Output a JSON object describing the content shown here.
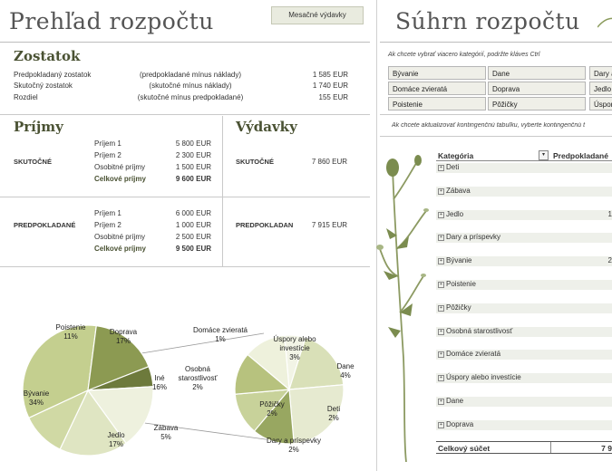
{
  "left": {
    "title": "Prehľad rozpočtu",
    "monthly_button": "Mesačné výdavky",
    "balance": {
      "heading": "Zostatok",
      "rows": [
        {
          "label": "Predpokladaný zostatok",
          "formula": "(predpokladané mínus náklady)",
          "value": "1 585 EUR"
        },
        {
          "label": "Skutočný zostatok",
          "formula": "(skutočné mínus náklady)",
          "value": "1 740 EUR"
        },
        {
          "label": "Rozdiel",
          "formula": "(skutočné mínus predpokladané)",
          "value": "155 EUR"
        }
      ]
    },
    "income": {
      "heading": "Príjmy",
      "actual": {
        "label": "SKUTOČNÉ",
        "rows": [
          {
            "label": "Príjem 1",
            "value": "5 800 EUR"
          },
          {
            "label": "Príjem 2",
            "value": "2 300 EUR"
          },
          {
            "label": "Osobitné príjmy",
            "value": "1 500 EUR"
          }
        ],
        "total_label": "Celkové príjmy",
        "total_value": "9 600 EUR"
      },
      "planned": {
        "label": "PREDPOKLADANÉ",
        "rows": [
          {
            "label": "Príjem 1",
            "value": "6 000 EUR"
          },
          {
            "label": "Príjem 2",
            "value": "1 000 EUR"
          },
          {
            "label": "Osobitné príjmy",
            "value": "2 500 EUR"
          }
        ],
        "total_label": "Celkové príjmy",
        "total_value": "9 500 EUR"
      }
    },
    "expenses": {
      "heading": "Výdavky",
      "actual_label": "SKUTOČNÉ",
      "actual_value": "7 860 EUR",
      "planned_label": "PREDPOKLADAN",
      "planned_value": "7 915 EUR"
    }
  },
  "right": {
    "title": "Súhrn rozpočtu",
    "hint_select": "Ak chcete vybrať viacero kategórií, podržte kláves Ctrl",
    "slicer_items": [
      "Bývanie",
      "Dane",
      "Dary a",
      "Domáce zvieratá",
      "Doprava",
      "Jedlo",
      "Poistenie",
      "Pôžičky",
      "Úspory"
    ],
    "hint_pivot": "Ak chcete aktualizovať kontingenčnú tabuľku, vyberte kontingenčnú t",
    "pivot": {
      "col_category": "Kategória",
      "col_planned": "Predpokladané",
      "rows": [
        "Deti",
        "Zábava",
        "Jedlo",
        "Dary a príspevky",
        "Bývanie",
        "Poistenie",
        "Pôžičky",
        "Osobná starostlivosť",
        "Domáce zvieratá",
        "Úspory alebo investície",
        "Dane",
        "Doprava"
      ],
      "partial_values": [
        "",
        "",
        "1",
        "",
        "2",
        "",
        "",
        "",
        "",
        "",
        "",
        ""
      ],
      "total_label": "Celkový súčet",
      "total_value": "7 9"
    }
  },
  "chart_data": [
    {
      "type": "pie",
      "categories": [
        "Bývanie",
        "Jedlo",
        "Zábava",
        "Iné",
        "Doprava",
        "Poistenie"
      ],
      "values": [
        34,
        17,
        5,
        16,
        17,
        11
      ],
      "labels": [
        "Bývanie\n34%",
        "Jedlo\n17%",
        "Zábava\n5%",
        "Iné\n16%",
        "Doprava\n17%",
        "Poistenie\n11%"
      ]
    },
    {
      "type": "pie",
      "categories": [
        "Domáce zvieratá",
        "Úspory alebo investície",
        "Dane",
        "Deti",
        "Dary a príspevky",
        "Pôžičky",
        "Osobná starostlivosť"
      ],
      "values": [
        1,
        3,
        4,
        2,
        2,
        2,
        2
      ],
      "labels": [
        "Domáce zvieratá\n1%",
        "Úspory alebo\ninvestície\n3%",
        "Dane\n4%",
        "Deti\n2%",
        "Dary a príspevky\n2%",
        "Pôžičky\n2%",
        "Osobná\nstarostlivosť\n2%"
      ]
    }
  ]
}
